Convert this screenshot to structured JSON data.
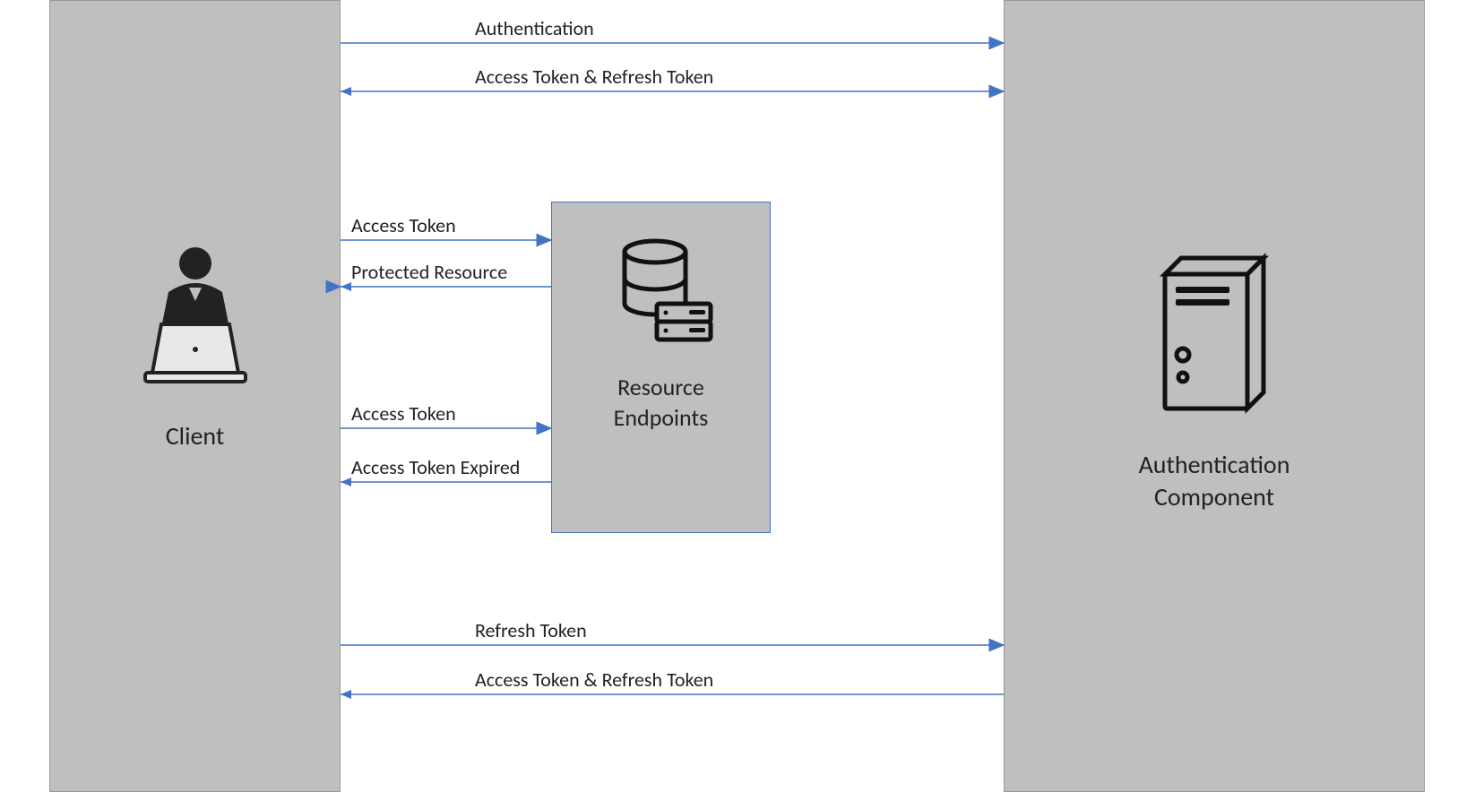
{
  "nodes": {
    "client": {
      "label": "Client"
    },
    "resource": {
      "label": "Resource\nEndpoints"
    },
    "auth": {
      "label": "Authentication\nComponent"
    }
  },
  "flows": {
    "f1": {
      "label": "Authentication"
    },
    "f2": {
      "label": "Access Token & Refresh Token"
    },
    "f3": {
      "label": "Access Token"
    },
    "f4": {
      "label": "Protected Resource"
    },
    "f5": {
      "label": "Access Token"
    },
    "f6": {
      "label": "Access Token Expired"
    },
    "f7": {
      "label": "Refresh Token"
    },
    "f8": {
      "label": "Access Token & Refresh Token"
    }
  }
}
